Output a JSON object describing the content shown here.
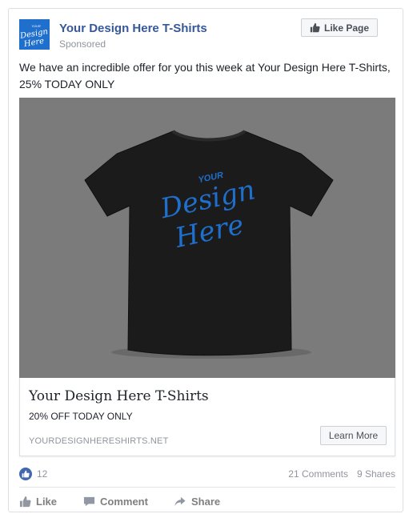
{
  "page": {
    "name": "Your Design Here T-Shirts",
    "sponsored_label": "Sponsored",
    "like_page_label": "Like Page",
    "logo_text": [
      "YOUR",
      "Design",
      "Here"
    ]
  },
  "post": {
    "text": "We have an incredible offer for you this week at Your Design Here T-Shirts, 25% TODAY ONLY"
  },
  "media": {
    "shirt_print": [
      "YOUR",
      "Design",
      "Here"
    ],
    "shirt_color": "#1b1b1b",
    "print_color": "#1f6fcc",
    "background_color": "#7b7b7b"
  },
  "link": {
    "headline": "Your Design Here T-Shirts",
    "description": "20% OFF TODAY ONLY",
    "domain": "YOURDESIGNHERESHIRTS.NET",
    "cta_label": "Learn More"
  },
  "stats": {
    "likes": "12",
    "comments": "21 Comments",
    "shares": "9 Shares"
  },
  "actions": {
    "like": "Like",
    "comment": "Comment",
    "share": "Share"
  },
  "colors": {
    "brand_blue": "#365899",
    "like_blue": "#4267b2"
  }
}
